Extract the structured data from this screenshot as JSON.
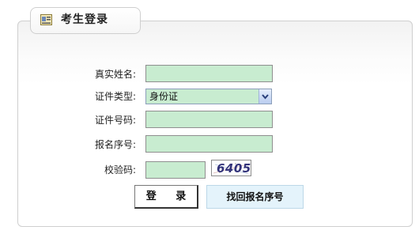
{
  "tab": {
    "title": "考生登录",
    "icon": "id-card-icon"
  },
  "form": {
    "name_label": "真实姓名:",
    "name_value": "",
    "id_type_label": "证件类型:",
    "id_type_selected": "身份证",
    "id_number_label": "证件号码:",
    "id_number_value": "",
    "reg_number_label": "报名序号:",
    "reg_number_value": "",
    "captcha_label": "校验码:",
    "captcha_value": "",
    "captcha_image_text": "6405"
  },
  "buttons": {
    "login_label": "登 录",
    "retrieve_label": "找回报名序号"
  },
  "colors": {
    "input_bg": "#c8ecd0",
    "retrieve_bg": "#e4f3fb"
  }
}
